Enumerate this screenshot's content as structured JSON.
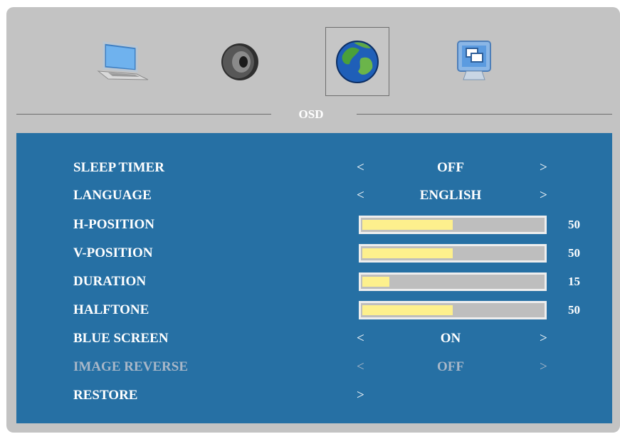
{
  "tabs": [
    {
      "icon": "laptop-icon",
      "selected": false
    },
    {
      "icon": "speaker-icon",
      "selected": false
    },
    {
      "icon": "globe-icon",
      "selected": true
    },
    {
      "icon": "display-settings-icon",
      "selected": false
    }
  ],
  "section_title": "OSD",
  "colors": {
    "panel": "#c3c3c3",
    "menu": "#2670a4",
    "bar_fill": "#fdf08d",
    "text": "#ffffff",
    "disabled_text": "#a8b7c8"
  },
  "menu": {
    "sleep_timer": {
      "label": "SLEEP TIMER",
      "prev": "<",
      "value": "OFF",
      "next": ">"
    },
    "language": {
      "label": "LANGUAGE",
      "prev": "<",
      "value": "ENGLISH",
      "next": ">"
    },
    "h_position": {
      "label": "H-POSITION",
      "level": 50,
      "max": 100,
      "value": "50"
    },
    "v_position": {
      "label": "V-POSITION",
      "level": 50,
      "max": 100,
      "value": "50"
    },
    "duration": {
      "label": "DURATION",
      "level": 15,
      "max": 100,
      "value": "15"
    },
    "halftone": {
      "label": "HALFTONE",
      "level": 50,
      "max": 100,
      "value": "50"
    },
    "blue_screen": {
      "label": "BLUE SCREEN",
      "prev": "<",
      "value": "ON",
      "next": ">"
    },
    "image_reverse": {
      "label": "IMAGE REVERSE",
      "prev": "<",
      "value": "OFF",
      "next": ">",
      "disabled": true
    },
    "restore": {
      "label": "RESTORE",
      "next": ">"
    }
  }
}
